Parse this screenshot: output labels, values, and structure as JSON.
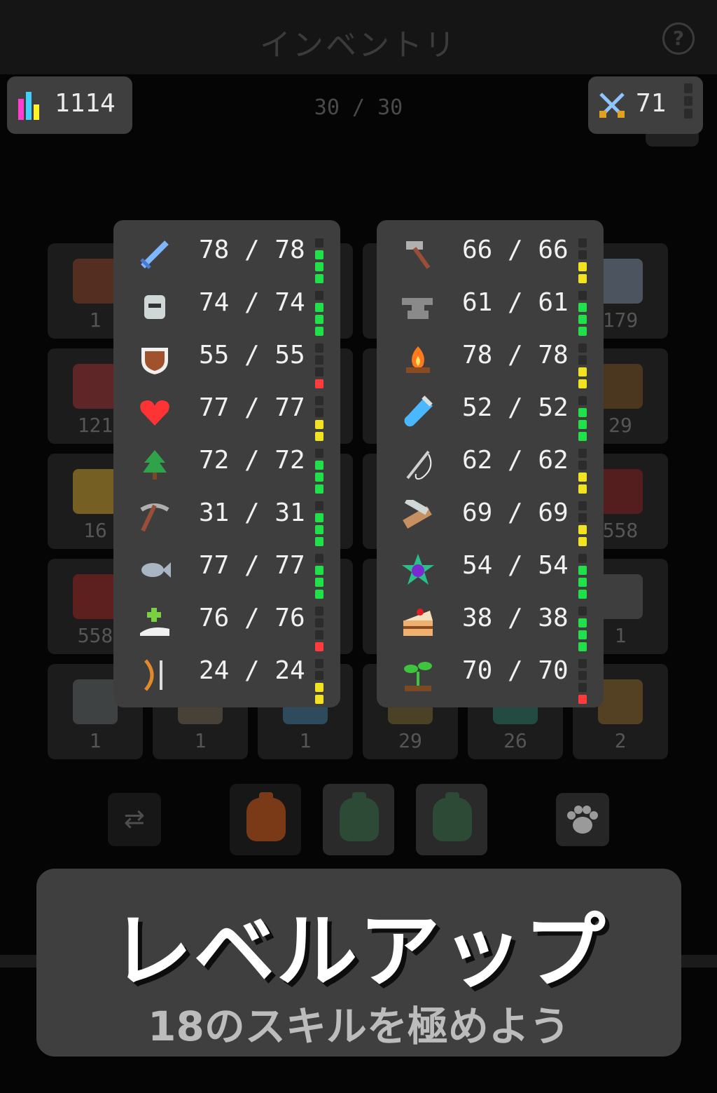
{
  "header": {
    "title": "インベントリ",
    "help_icon": "?"
  },
  "total_level": {
    "value": "1114",
    "icon": "bar-chart-icon"
  },
  "capacity": "30 / 30",
  "combat_level": {
    "value": "71",
    "icon": "crossed-swords-icon"
  },
  "inventory": {
    "slots": [
      {
        "count": "1",
        "color": "#7a3b24"
      },
      {
        "count": "",
        "color": "#333"
      },
      {
        "count": "",
        "color": "#333"
      },
      {
        "count": "",
        "color": "#333"
      },
      {
        "count": "",
        "color": "#333"
      },
      {
        "count": "179",
        "color": "#6b7a8c"
      },
      {
        "count": "121",
        "color": "#8b2d2d"
      },
      {
        "count": "",
        "color": "#333"
      },
      {
        "count": "",
        "color": "#333"
      },
      {
        "count": "",
        "color": "#333"
      },
      {
        "count": "",
        "color": "#333"
      },
      {
        "count": "29",
        "color": "#6b4a22"
      },
      {
        "count": "16",
        "color": "#b08c28"
      },
      {
        "count": "",
        "color": "#333"
      },
      {
        "count": "",
        "color": "#333"
      },
      {
        "count": "",
        "color": "#333"
      },
      {
        "count": "",
        "color": "#333"
      },
      {
        "count": "558",
        "color": "#7a1f1f"
      },
      {
        "count": "558",
        "color": "#8b2222"
      },
      {
        "count": "",
        "color": "#333"
      },
      {
        "count": "",
        "color": "#333"
      },
      {
        "count": "",
        "color": "#333"
      },
      {
        "count": "",
        "color": "#333"
      },
      {
        "count": "1",
        "color": "#555"
      },
      {
        "count": "1",
        "color": "#555b5e"
      },
      {
        "count": "1",
        "color": "#665a4a"
      },
      {
        "count": "1",
        "color": "#3a6a8a"
      },
      {
        "count": "29",
        "color": "#6b5a2a"
      },
      {
        "count": "26",
        "color": "#2a6a5a"
      },
      {
        "count": "2",
        "color": "#7a5a2a"
      }
    ]
  },
  "bottom_tools": {
    "swap_icon": "swap-arrows-icon",
    "bags": [
      {
        "name": "bag-red",
        "color": "#7a3a18"
      },
      {
        "name": "bag-green-1",
        "color": "#2c4a36"
      },
      {
        "name": "bag-green-2",
        "color": "#2c4a36"
      }
    ],
    "pet_icon": "paw-icon"
  },
  "skills_left": [
    {
      "icon": "sword-icon",
      "color": "#7fb7ff",
      "value": "78 / 78",
      "pips": [
        0,
        1,
        1,
        1
      ]
    },
    {
      "icon": "helmet-icon",
      "color": "#cfd8d6",
      "value": "74 / 74",
      "pips": [
        0,
        1,
        1,
        1
      ]
    },
    {
      "icon": "shield-icon",
      "color": "#a0522d",
      "value": "55 / 55",
      "pips": [
        0,
        0,
        0,
        3
      ]
    },
    {
      "icon": "heart-icon",
      "color": "#ff3333",
      "value": "77 / 77",
      "pips": [
        0,
        0,
        2,
        2
      ]
    },
    {
      "icon": "tree-icon",
      "color": "#2fa24a",
      "value": "72 / 72",
      "pips": [
        0,
        1,
        1,
        1
      ]
    },
    {
      "icon": "pickaxe-icon",
      "color": "#9a4e3a",
      "value": "31 / 31",
      "pips": [
        0,
        1,
        1,
        1
      ]
    },
    {
      "icon": "fish-icon",
      "color": "#a8b5c2",
      "value": "77 / 77",
      "pips": [
        0,
        1,
        1,
        1
      ]
    },
    {
      "icon": "healing-hand-icon",
      "color": "#f0f0f0",
      "value": "76 / 76",
      "pips": [
        0,
        0,
        0,
        3
      ]
    },
    {
      "icon": "bow-arrow-icon",
      "color": "#e08a2c",
      "value": "24 / 24",
      "pips": [
        0,
        0,
        2,
        2
      ]
    }
  ],
  "skills_right": [
    {
      "icon": "hammer-icon",
      "color": "#b0b0b0",
      "value": "66 / 66",
      "pips": [
        0,
        0,
        2,
        2
      ]
    },
    {
      "icon": "anvil-icon",
      "color": "#8a8a8a",
      "value": "61 / 61",
      "pips": [
        0,
        1,
        1,
        1
      ]
    },
    {
      "icon": "campfire-icon",
      "color": "#ff7a1a",
      "value": "78 / 78",
      "pips": [
        0,
        0,
        2,
        2
      ]
    },
    {
      "icon": "potion-vial-icon",
      "color": "#4ab7ff",
      "value": "52 / 52",
      "pips": [
        0,
        1,
        1,
        1
      ]
    },
    {
      "icon": "needle-thread-icon",
      "color": "#d0d0d0",
      "value": "62 / 62",
      "pips": [
        0,
        0,
        2,
        2
      ]
    },
    {
      "icon": "saw-wood-icon",
      "color": "#c69060",
      "value": "69 / 69",
      "pips": [
        0,
        0,
        2,
        2
      ]
    },
    {
      "icon": "magic-star-icon",
      "color": "#7a2ad0",
      "value": "54 / 54",
      "pips": [
        0,
        1,
        1,
        1
      ]
    },
    {
      "icon": "cake-icon",
      "color": "#f0b070",
      "value": "38 / 38",
      "pips": [
        0,
        1,
        1,
        1
      ]
    },
    {
      "icon": "sprout-icon",
      "color": "#3fc43f",
      "value": "70 / 70",
      "pips": [
        0,
        0,
        0,
        3
      ]
    }
  ],
  "pip_colors": {
    "off": "#2b2b2b",
    "green": "#21e14a",
    "yellow": "#f1e322",
    "red": "#ff3b3b"
  },
  "promo": {
    "title": "レベルアップ",
    "subtitle": "18のスキルを極めよう"
  }
}
